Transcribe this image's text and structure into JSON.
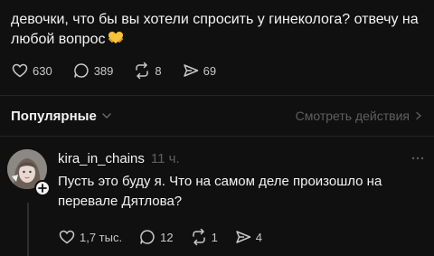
{
  "post": {
    "text": "девочки, что бы вы хотели спросить у гинеколога? отвечу на любой вопрос",
    "emoji": "heart-hands-emoji",
    "stats": {
      "likes": "630",
      "replies": "389",
      "reposts": "8",
      "shares": "69"
    }
  },
  "sort": {
    "label": "Популярные",
    "actions_link": "Смотреть действия"
  },
  "comment": {
    "username": "kira_in_chains",
    "time": "11 ч.",
    "text": "Пусть это буду я. Что на самом деле произошло на перевале Дятлова?",
    "stats": {
      "likes": "1,7 тыс.",
      "replies": "12",
      "reposts": "1",
      "shares": "4"
    }
  },
  "colors": {
    "background": "#101010",
    "text": "#f3f3f3",
    "muted": "#5f5f5f",
    "emoji": "#f6c33b"
  }
}
